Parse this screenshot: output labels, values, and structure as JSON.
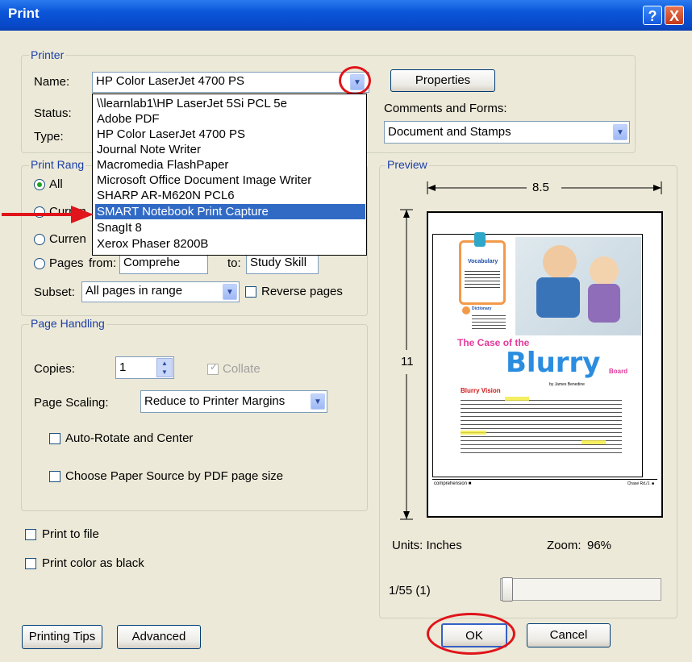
{
  "window": {
    "title": "Print",
    "help_glyph": "?",
    "close_glyph": "X"
  },
  "printer": {
    "group_label": "Printer",
    "name_label": "Name:",
    "name_value": "HP Color LaserJet 4700 PS",
    "status_label": "Status:",
    "type_label": "Type:",
    "properties_label": "Properties",
    "comments_label": "Comments and Forms:",
    "comments_value": "Document and Stamps",
    "dropdown_items": [
      "\\\\learnlab1\\HP LaserJet 5Si PCL 5e",
      "Adobe PDF",
      "HP Color LaserJet 4700 PS",
      "Journal Note Writer",
      "Macromedia FlashPaper",
      "Microsoft Office Document Image Writer",
      "SHARP AR-M620N PCL6",
      "SMART Notebook Print Capture",
      "SnagIt 8",
      "Xerox Phaser 8200B"
    ],
    "selected_index": 7
  },
  "range": {
    "group_label": "Print Rang",
    "all_label": "All",
    "current_view_label": "Curren",
    "current_page_label": "Curren",
    "pages_label": "Pages",
    "from_label": "from:",
    "from_value": "Comprehe",
    "to_label": "to:",
    "to_value": "Study Skill",
    "subset_label": "Subset:",
    "subset_value": "All pages in range",
    "reverse_label": "Reverse pages"
  },
  "handling": {
    "group_label": "Page Handling",
    "copies_label": "Copies:",
    "copies_value": "1",
    "collate_label": "Collate",
    "scaling_label": "Page Scaling:",
    "scaling_value": "Reduce to Printer Margins",
    "autorotate_label": "Auto-Rotate and Center",
    "paper_source_label": "Choose Paper Source by PDF page size"
  },
  "options": {
    "print_to_file_label": "Print to file",
    "print_color_black_label": "Print color as black"
  },
  "preview": {
    "group_label": "Preview",
    "width_value": "8.5",
    "height_value": "11",
    "units_label": "Units: Inches",
    "zoom_label": "Zoom:",
    "zoom_value": "96%",
    "page_indicator": "1/55 (1)",
    "slider_level": 0.0,
    "thumb": {
      "header_word": "Vocabulary",
      "small_header": "Dictionary",
      "headline1": "The Case of the",
      "headline2": "Blurry",
      "headline3": "Board",
      "byline": "by James Benedine",
      "subhead": "Blurry Vision",
      "footer_left": "comprehension ■",
      "footer_right": "Chase Rd./J. ■"
    }
  },
  "buttons": {
    "printing_tips": "Printing Tips",
    "advanced": "Advanced",
    "ok": "OK",
    "cancel": "Cancel"
  },
  "colors": {
    "accent": "#316ac5",
    "annotation": "#e0141a",
    "titlebar": "#0a55d8"
  }
}
